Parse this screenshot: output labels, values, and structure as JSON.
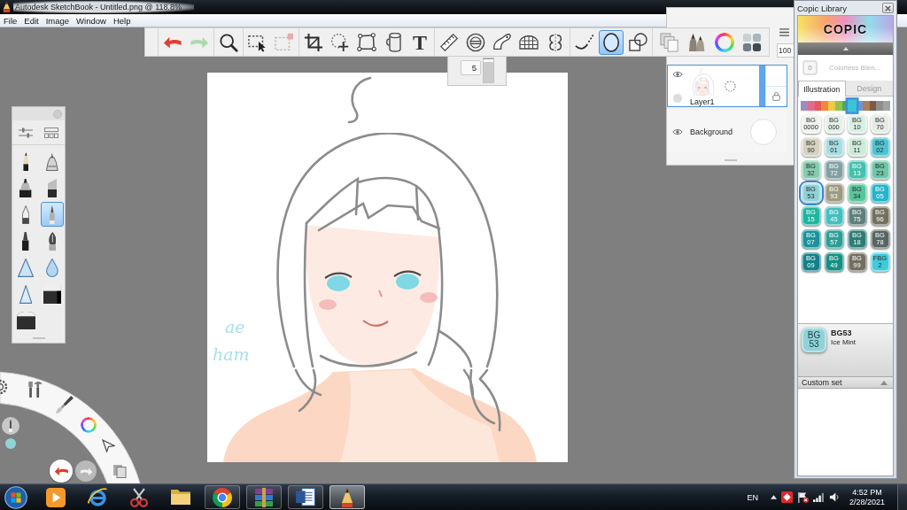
{
  "window": {
    "title": "Autodesk SketchBook - Untitled.png @ 118.8%"
  },
  "menu": [
    "File",
    "Edit",
    "Image",
    "Window",
    "Help"
  ],
  "toolbar": {
    "groups": [
      {
        "tools": [
          {
            "kind": "undo",
            "selected": false,
            "disabled": false
          },
          {
            "kind": "redo",
            "selected": false,
            "disabled": true
          }
        ]
      },
      {
        "tools": [
          {
            "kind": "zoom",
            "selected": false,
            "disabled": false
          }
        ]
      },
      {
        "tools": [
          {
            "kind": "select",
            "selected": false,
            "disabled": false
          },
          {
            "kind": "select-edit",
            "selected": false,
            "disabled": true
          }
        ]
      },
      {
        "tools": [
          {
            "kind": "crop",
            "selected": false,
            "disabled": false
          },
          {
            "kind": "move",
            "selected": false,
            "disabled": false
          },
          {
            "kind": "distort",
            "selected": false,
            "disabled": false
          },
          {
            "kind": "bucket",
            "selected": false,
            "disabled": false
          },
          {
            "kind": "text",
            "glyph": "T",
            "selected": false,
            "disabled": false
          }
        ]
      },
      {
        "tools": [
          {
            "kind": "ruler",
            "selected": false,
            "disabled": false
          },
          {
            "kind": "ellipse-guide",
            "selected": false,
            "disabled": false
          },
          {
            "kind": "french-curve",
            "selected": false,
            "disabled": false
          },
          {
            "kind": "perspective",
            "selected": false,
            "disabled": false
          },
          {
            "kind": "symmetry",
            "selected": false,
            "disabled": false
          }
        ]
      },
      {
        "tools": [
          {
            "kind": "stroke",
            "selected": false,
            "disabled": false
          },
          {
            "kind": "ellipse",
            "selected": true,
            "disabled": false
          },
          {
            "kind": "shapes",
            "selected": false,
            "disabled": false
          }
        ]
      },
      {
        "tools": [
          {
            "kind": "copy",
            "selected": false,
            "disabled": false
          },
          {
            "kind": "brushes",
            "selected": false,
            "disabled": false
          },
          {
            "kind": "color-wheel",
            "selected": false,
            "disabled": false
          },
          {
            "kind": "swatches",
            "selected": false,
            "disabled": false
          }
        ]
      }
    ]
  },
  "brush_size": {
    "value": "5",
    "level": 0.95
  },
  "layers": {
    "opacity": "100",
    "items": [
      {
        "kind": "paint",
        "name": "Layer1",
        "selected": true,
        "visible": true,
        "level": 1
      },
      {
        "kind": "background",
        "name": "Background",
        "selected": false,
        "visible": true
      }
    ]
  },
  "brush_palette": {
    "brushes": [
      {
        "kind": "pencil",
        "selected": false
      },
      {
        "kind": "tech-pen",
        "selected": false
      },
      {
        "kind": "marker",
        "selected": false
      },
      {
        "kind": "chisel",
        "selected": false
      },
      {
        "kind": "ballpoint",
        "selected": false
      },
      {
        "kind": "ink-pen",
        "selected": true
      },
      {
        "kind": "felt-pen",
        "selected": false
      },
      {
        "kind": "nib",
        "selected": false
      },
      {
        "kind": "airbrush",
        "selected": false
      },
      {
        "kind": "drop",
        "selected": false
      },
      {
        "kind": "hard-airbrush",
        "selected": false
      },
      {
        "kind": "eraser",
        "selected": false
      },
      {
        "kind": "soft-eraser",
        "selected": false
      }
    ]
  },
  "canvas": {
    "handwriting": [
      "ae",
      "ham"
    ]
  },
  "lagoon": {
    "color": "#8fd3d8"
  },
  "copic": {
    "title": "Copic Library",
    "logo": "COPIC",
    "blender": {
      "code": "0",
      "name": "Colorless Blen..."
    },
    "tabs": [
      {
        "label": "Illustration",
        "selected": true
      },
      {
        "label": "Design",
        "selected": false
      }
    ],
    "hues": [
      {
        "color": "#a08cc0",
        "selected": false
      },
      {
        "color": "#e46a8a",
        "selected": false
      },
      {
        "color": "#e55a5a",
        "selected": false
      },
      {
        "color": "#f2883c",
        "selected": false
      },
      {
        "color": "#f0c84a",
        "selected": false
      },
      {
        "color": "#93c24c",
        "selected": false
      },
      {
        "color": "#4faa5a",
        "selected": false
      },
      {
        "color": "#3cc4d4",
        "selected": true
      },
      {
        "color": "#6c98d2",
        "selected": false
      },
      {
        "color": "#a9805a",
        "selected": false
      },
      {
        "color": "#7e5a45",
        "selected": false
      },
      {
        "color": "#8e8e8e",
        "selected": false
      },
      {
        "color": "#a3a3a3",
        "selected": false
      }
    ],
    "swatches": [
      {
        "series": "BG",
        "number": "0000",
        "color": "#eef3ef",
        "selected": false
      },
      {
        "series": "BG",
        "number": "000",
        "color": "#e4f1ea",
        "selected": false
      },
      {
        "series": "BG",
        "number": "10",
        "color": "#d9efe5",
        "selected": false
      },
      {
        "series": "BG",
        "number": "70",
        "color": "#e6ebe6",
        "selected": false
      },
      {
        "series": "BG",
        "number": "90",
        "color": "#d6d2c0",
        "selected": false
      },
      {
        "series": "BG",
        "number": "01",
        "color": "#a8dde3",
        "selected": false
      },
      {
        "series": "BG",
        "number": "11",
        "color": "#cdeadb",
        "selected": false
      },
      {
        "series": "BG",
        "number": "02",
        "color": "#4ec4d3",
        "selected": false
      },
      {
        "series": "BG",
        "number": "32",
        "color": "#86cbb0",
        "selected": false
      },
      {
        "series": "BG",
        "number": "72",
        "color": "#82a0a2",
        "selected": false
      },
      {
        "series": "BG",
        "number": "13",
        "color": "#45c0ae",
        "selected": false
      },
      {
        "series": "BG",
        "number": "23",
        "color": "#6ec7a8",
        "selected": false
      },
      {
        "series": "BG",
        "number": "53",
        "color": "#8fd3d8",
        "selected": true
      },
      {
        "series": "BG",
        "number": "93",
        "color": "#9c9a80",
        "selected": false
      },
      {
        "series": "BG",
        "number": "34",
        "color": "#58c69d",
        "selected": false
      },
      {
        "series": "BG",
        "number": "05",
        "color": "#23b5cb",
        "selected": false
      },
      {
        "series": "BG",
        "number": "15",
        "color": "#1fb59e",
        "selected": false
      },
      {
        "series": "BG",
        "number": "45",
        "color": "#42bfbf",
        "selected": false
      },
      {
        "series": "BG",
        "number": "75",
        "color": "#5f7f7b",
        "selected": false
      },
      {
        "series": "BG",
        "number": "96",
        "color": "#72705f",
        "selected": false
      },
      {
        "series": "BG",
        "number": "07",
        "color": "#1a929c",
        "selected": false
      },
      {
        "series": "BG",
        "number": "57",
        "color": "#2c9e95",
        "selected": false
      },
      {
        "series": "BG",
        "number": "18",
        "color": "#2f7c76",
        "selected": false
      },
      {
        "series": "BG",
        "number": "78",
        "color": "#556663",
        "selected": false
      },
      {
        "series": "BG",
        "number": "09",
        "color": "#148088",
        "selected": false
      },
      {
        "series": "BG",
        "number": "49",
        "color": "#168f83",
        "selected": false
      },
      {
        "series": "BG",
        "number": "99",
        "color": "#726e60",
        "selected": false
      },
      {
        "series": "FBG",
        "number": "2",
        "color": "#3ecbdc",
        "selected": false
      }
    ],
    "current": {
      "series": "BG",
      "number": "53",
      "code": "BG53",
      "name": "Ice Mint",
      "color": "#8fd3d8"
    },
    "custom_set": {
      "label": "Custom set"
    }
  },
  "taskbar": {
    "apps": [
      {
        "kind": "player",
        "running": false,
        "selected": false
      },
      {
        "kind": "globe",
        "running": false,
        "selected": false
      },
      {
        "kind": "scissors",
        "running": false,
        "selected": false
      },
      {
        "kind": "folder",
        "running": false,
        "selected": false
      },
      {
        "kind": "ring",
        "running": true,
        "selected": false
      },
      {
        "kind": "books",
        "running": true,
        "selected": false
      },
      {
        "kind": "document",
        "running": true,
        "selected": false
      },
      {
        "kind": "pencil",
        "running": true,
        "selected": true
      }
    ],
    "language": "EN",
    "time": "4:52 PM",
    "date": "2/28/2021"
  }
}
